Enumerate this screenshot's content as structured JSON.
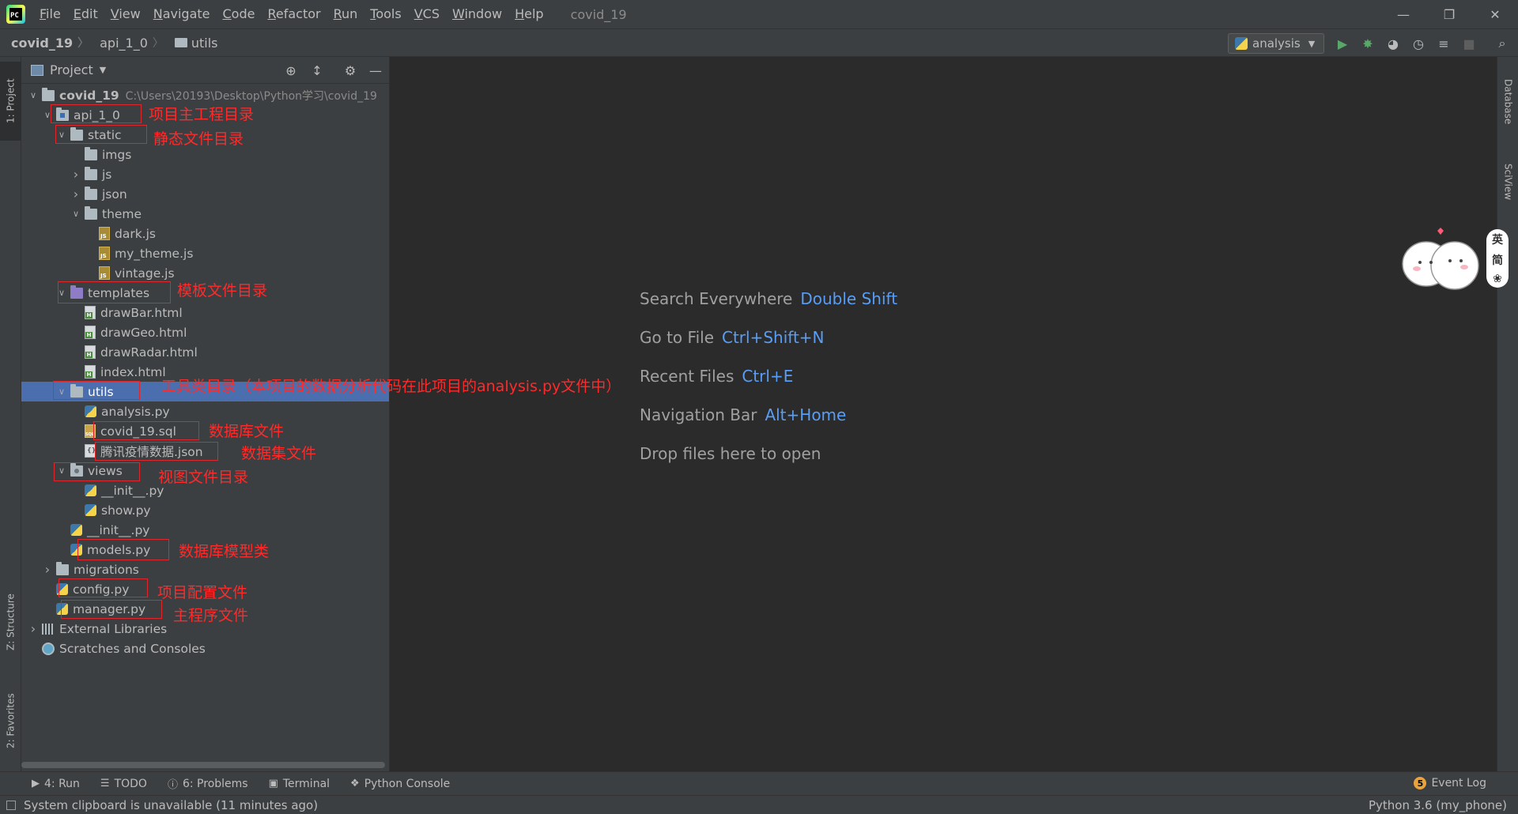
{
  "menubar": {
    "items": [
      "File",
      "Edit",
      "View",
      "Navigate",
      "Code",
      "Refactor",
      "Run",
      "Tools",
      "VCS",
      "Window",
      "Help"
    ],
    "window_title": "covid_19"
  },
  "navbar": {
    "breadcrumb": [
      "covid_19",
      "api_1_0",
      "utils"
    ],
    "run_config": "analysis"
  },
  "left_stripe": {
    "project_tab": "1: Project",
    "structure_tab": "Z: Structure",
    "favorites_tab": "2: Favorites"
  },
  "right_stripe": {
    "database_tab": "Database",
    "sciview_tab": "SciView"
  },
  "project_panel": {
    "title": "Project",
    "tree": [
      {
        "label": "covid_19",
        "path": "C:\\Users\\20193\\Desktop\\Python学习\\covid_19",
        "depth": 0,
        "expanded": true,
        "icon": "folder"
      },
      {
        "label": "api_1_0",
        "depth": 1,
        "expanded": true,
        "icon": "folder-module"
      },
      {
        "label": "static",
        "depth": 2,
        "expanded": true,
        "icon": "folder"
      },
      {
        "label": "imgs",
        "depth": 3,
        "icon": "folder"
      },
      {
        "label": "js",
        "depth": 3,
        "expanded": false,
        "icon": "folder"
      },
      {
        "label": "json",
        "depth": 3,
        "expanded": false,
        "icon": "folder"
      },
      {
        "label": "theme",
        "depth": 3,
        "expanded": true,
        "icon": "folder"
      },
      {
        "label": "dark.js",
        "depth": 4,
        "icon": "js"
      },
      {
        "label": "my_theme.js",
        "depth": 4,
        "icon": "js"
      },
      {
        "label": "vintage.js",
        "depth": 4,
        "icon": "js"
      },
      {
        "label": "templates",
        "depth": 2,
        "expanded": true,
        "icon": "folder-purple"
      },
      {
        "label": "drawBar.html",
        "depth": 3,
        "icon": "html"
      },
      {
        "label": "drawGeo.html",
        "depth": 3,
        "icon": "html"
      },
      {
        "label": "drawRadar.html",
        "depth": 3,
        "icon": "html"
      },
      {
        "label": "index.html",
        "depth": 3,
        "icon": "html"
      },
      {
        "label": "utils",
        "depth": 2,
        "expanded": true,
        "icon": "folder",
        "selected": true
      },
      {
        "label": "analysis.py",
        "depth": 3,
        "icon": "py"
      },
      {
        "label": "covid_19.sql",
        "depth": 3,
        "icon": "sql"
      },
      {
        "label": "腾讯疫情数据.json",
        "depth": 3,
        "icon": "json"
      },
      {
        "label": "views",
        "depth": 2,
        "expanded": true,
        "icon": "folder-pkg"
      },
      {
        "label": "__init__.py",
        "depth": 3,
        "icon": "py"
      },
      {
        "label": "show.py",
        "depth": 3,
        "icon": "py"
      },
      {
        "label": "__init__.py",
        "depth": 2,
        "icon": "py"
      },
      {
        "label": "models.py",
        "depth": 2,
        "icon": "py"
      },
      {
        "label": "migrations",
        "depth": 1,
        "expanded": false,
        "icon": "folder"
      },
      {
        "label": "config.py",
        "depth": 1,
        "icon": "py"
      },
      {
        "label": "manager.py",
        "depth": 1,
        "icon": "py"
      },
      {
        "label": "External Libraries",
        "depth": 0,
        "expanded": false,
        "icon": "lib"
      },
      {
        "label": "Scratches and Consoles",
        "depth": 0,
        "icon": "scratch"
      }
    ]
  },
  "annotations": {
    "api": "项目主工程目录",
    "static": "静态文件目录",
    "templates": "模板文件目录",
    "utils": "工具类目录（本项目的数据分析代码在此项目的analysis.py文件中）",
    "sql": "数据库文件",
    "json": "数据集文件",
    "views": "视图文件目录",
    "models": "数据库模型类",
    "config": "项目配置文件",
    "manager": "主程序文件"
  },
  "editor_hints": [
    {
      "label": "Search Everywhere",
      "key": "Double Shift"
    },
    {
      "label": "Go to File",
      "key": "Ctrl+Shift+N"
    },
    {
      "label": "Recent Files",
      "key": "Ctrl+E"
    },
    {
      "label": "Navigation Bar",
      "key": "Alt+Home"
    },
    {
      "label": "Drop files here to open",
      "key": ""
    }
  ],
  "ime": {
    "lang": "英",
    "mode": "简"
  },
  "bottom_tools": {
    "run": "4: Run",
    "todo": "TODO",
    "problems": "6: Problems",
    "terminal": "Terminal",
    "python_console": "Python Console",
    "event_log": "Event Log",
    "event_count": "5"
  },
  "status": {
    "message": "System clipboard is unavailable (11 minutes ago)",
    "interpreter": "Python 3.6 (my_phone)"
  },
  "colors": {
    "accent_blue": "#589df6",
    "selection": "#4b6eaf",
    "annotation_red": "#ff2a2a",
    "run_green": "#59a869"
  }
}
